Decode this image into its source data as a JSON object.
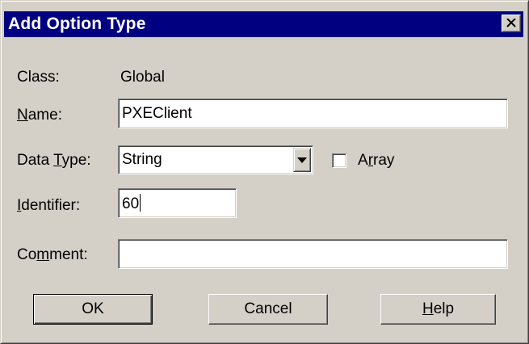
{
  "window": {
    "title": "Add Option Type",
    "close_icon": "close-icon"
  },
  "form": {
    "class_label": "Class:",
    "class_value": "Global",
    "name_label_prefix": "",
    "name_label_mnemonic": "N",
    "name_label_suffix": "ame:",
    "name_value": "PXEClient",
    "datatype_label_prefix": "Data ",
    "datatype_label_mnemonic": "T",
    "datatype_label_suffix": "ype:",
    "datatype_value": "String",
    "array_label_prefix": "A",
    "array_label_mnemonic": "r",
    "array_label_suffix": "ray",
    "array_checked": false,
    "identifier_label_prefix": "",
    "identifier_label_mnemonic": "I",
    "identifier_label_suffix": "dentifier:",
    "identifier_value": "60",
    "comment_label_prefix": "Co",
    "comment_label_mnemonic": "m",
    "comment_label_suffix": "ment:",
    "comment_value": ""
  },
  "buttons": {
    "ok_label": "OK",
    "cancel_label": "Cancel",
    "help_label_mnemonic": "H",
    "help_label_suffix": "elp"
  },
  "colors": {
    "titlebar": "#000080",
    "face": "#d4d0c8"
  }
}
